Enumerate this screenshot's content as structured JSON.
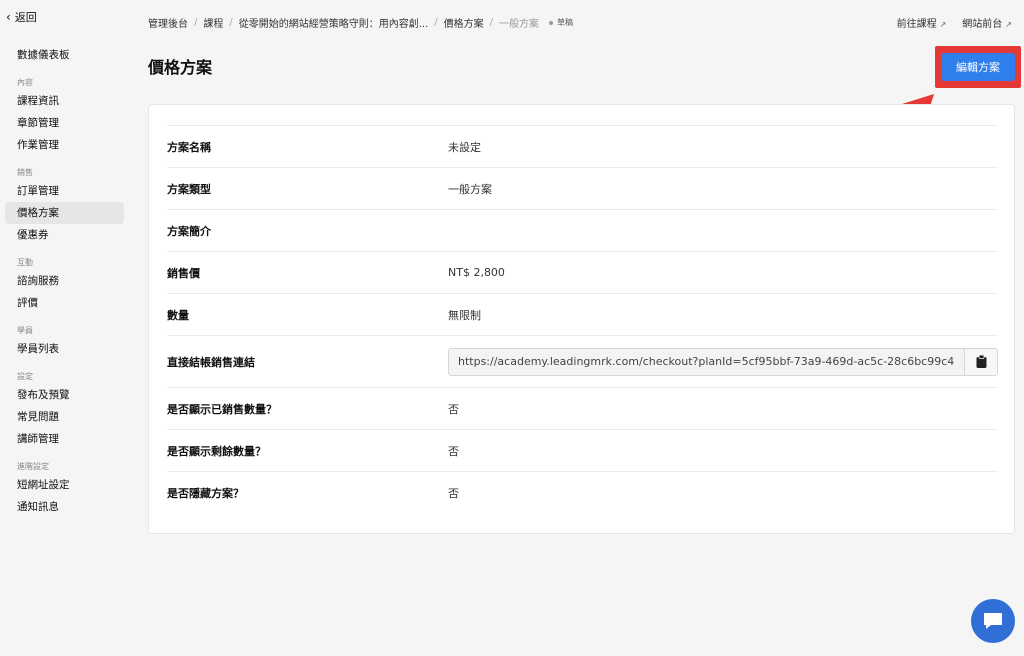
{
  "sidebar": {
    "back_label": "返回",
    "dashboard": "數據儀表板",
    "groups": [
      {
        "title": "內容",
        "items": [
          "課程資訊",
          "章節管理",
          "作業管理"
        ]
      },
      {
        "title": "銷售",
        "items": [
          "訂單管理",
          "價格方案",
          "優惠券"
        ]
      },
      {
        "title": "互動",
        "items": [
          "諮詢服務",
          "評價"
        ]
      },
      {
        "title": "學員",
        "items": [
          "學員列表"
        ]
      },
      {
        "title": "設定",
        "items": [
          "發布及預覽",
          "常見問題",
          "講師管理"
        ]
      },
      {
        "title": "進階設定",
        "items": [
          "短網址設定",
          "通知訊息"
        ]
      }
    ],
    "active": "價格方案"
  },
  "breadcrumb": {
    "items": [
      "管理後台",
      "課程",
      "從零開始的網站經營策略守則：用內容創...",
      "價格方案",
      "一般方案"
    ],
    "status": "草稿"
  },
  "toplinks": {
    "course": "前往課程",
    "site": "網站前台"
  },
  "page": {
    "title": "價格方案",
    "edit_button": "編輯方案"
  },
  "details": [
    {
      "label": "方案名稱",
      "value": "未設定"
    },
    {
      "label": "方案類型",
      "value": "一般方案"
    },
    {
      "label": "方案簡介",
      "value": ""
    },
    {
      "label": "銷售價",
      "value": "NT$ 2,800"
    },
    {
      "label": "數量",
      "value": "無限制"
    },
    {
      "label": "直接結帳銷售連結",
      "value": "https://academy.leadingmrk.com/checkout?planId=5cf95bbf-73a9-469d-ac5c-28c6bc99c4"
    },
    {
      "label": "是否顯示已銷售數量？",
      "value": "否"
    },
    {
      "label": "是否顯示剩餘數量？",
      "value": "否"
    },
    {
      "label": "是否隱藏方案？",
      "value": "否"
    }
  ],
  "colors": {
    "accent": "#2f80ed",
    "highlight": "#e53935",
    "chat": "#2f6fd6"
  },
  "icons": {
    "back": "chevron-left-icon",
    "external": "external-link-icon",
    "copy": "clipboard-icon",
    "chat": "chat-bubble-icon",
    "annotation": "red-arrow-icon"
  }
}
